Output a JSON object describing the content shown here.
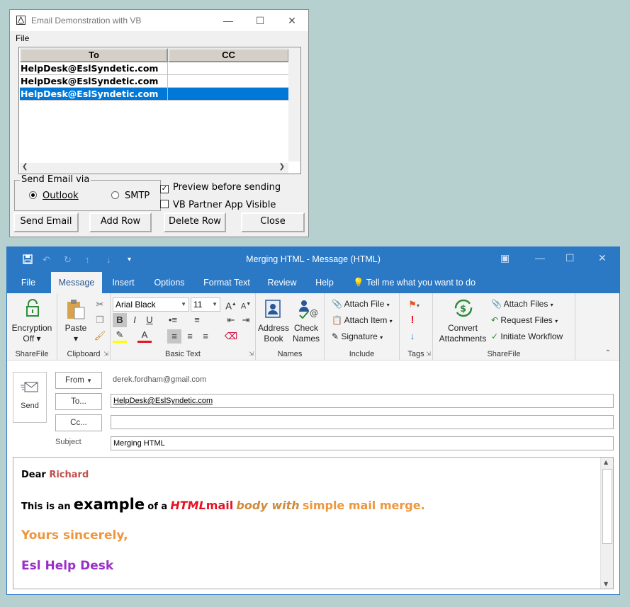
{
  "vb": {
    "title": "Email Demonstration with VB",
    "menu_file": "File",
    "grid": {
      "headers": [
        "To",
        "CC"
      ],
      "rows": [
        {
          "to": "HelpDesk@EslSyndetic.com",
          "cc": ""
        },
        {
          "to": "HelpDesk@EslSyndetic.com",
          "cc": ""
        },
        {
          "to": "HelpDesk@EslSyndetic.com",
          "cc": ""
        }
      ],
      "selected_row": 3
    },
    "send_via_label": "Send Email via",
    "radio_outlook": "Outlook",
    "radio_smtp": "SMTP",
    "selected_method": "Outlook",
    "preview_label": "Preview before sending",
    "preview_checked": true,
    "partner_label": "VB Partner App Visible",
    "partner_checked": false,
    "buttons": {
      "send": "Send Email",
      "add": "Add Row",
      "delete": "Delete Row",
      "close": "Close"
    }
  },
  "outlook": {
    "title": "Merging HTML  -  Message (HTML)",
    "tabs": [
      "File",
      "Message",
      "Insert",
      "Options",
      "Format Text",
      "Review",
      "Help"
    ],
    "active_tab": "Message",
    "tell_me": "Tell me what you want to do",
    "ribbon": {
      "encryption_line1": "Encryption",
      "encryption_line2": "Off",
      "sharefile_label": "ShareFile",
      "paste": "Paste",
      "clipboard_label": "Clipboard",
      "font_name": "Arial Black",
      "font_size": "11",
      "basic_text_label": "Basic Text",
      "address_book_1": "Address",
      "address_book_2": "Book",
      "check_names_1": "Check",
      "check_names_2": "Names",
      "names_label": "Names",
      "attach_file": "Attach File",
      "attach_item": "Attach Item",
      "signature": "Signature",
      "include_label": "Include",
      "tags_label": "Tags",
      "convert_1": "Convert",
      "convert_2": "Attachments",
      "attach_files": "Attach Files",
      "request_files": "Request Files",
      "initiate_workflow": "Initiate Workflow",
      "sharefile2_label": "ShareFile"
    },
    "send_label": "Send",
    "from_button": "From",
    "from_value": "derek.fordham@gmail.com",
    "to_button": "To...",
    "to_value": "HelpDesk@EslSyndetic.com",
    "cc_button": "Cc...",
    "cc_value": "",
    "subject_label": "Subject",
    "subject_value": "Merging HTML",
    "body": {
      "dear": "Dear",
      "name": "Richard",
      "l2_a": "This is an",
      "l2_b": "example",
      "l2_c": "of a",
      "l2_d": "HTML",
      "l2_e": "mail",
      "l2_f": "body with",
      "l2_g": "simple mail merge.",
      "closing": "Yours sincerely,",
      "signature": "Esl Help Desk"
    }
  }
}
